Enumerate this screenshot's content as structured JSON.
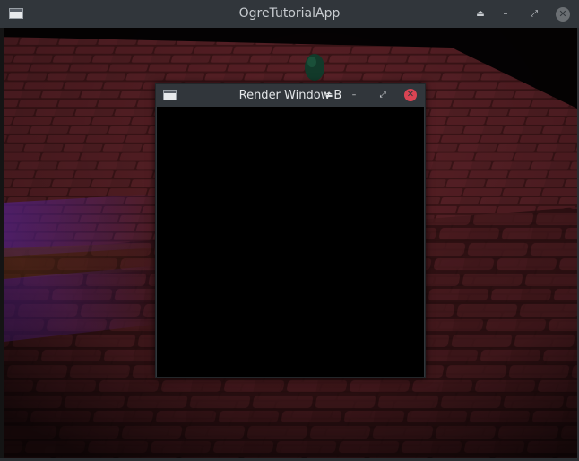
{
  "main_window": {
    "title": "OgreTutorialApp",
    "icon": "window-icon",
    "buttons": {
      "keep_above": "⏏",
      "minimize": "–",
      "maximize": "⤢",
      "close": "✕"
    }
  },
  "sub_window": {
    "title": "Render Window B",
    "icon": "window-icon",
    "buttons": {
      "keep_above": "⏏",
      "minimize": "–",
      "maximize": "⤢",
      "close": "✕"
    }
  },
  "colors": {
    "titlebar": "#31363b",
    "close_active": "#da4453",
    "close_inactive": "#6b6f73",
    "floor_brick": "#4a1a1e",
    "floor_light_purple": "#5a2a8a"
  }
}
